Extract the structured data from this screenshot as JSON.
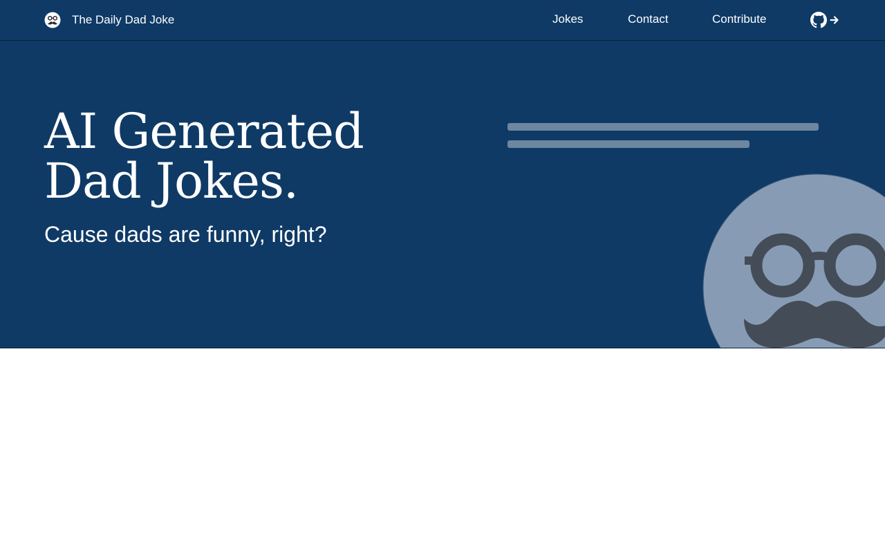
{
  "navbar": {
    "brand": "The Daily Dad Joke",
    "links": {
      "jokes": "Jokes",
      "contact": "Contact",
      "contribute": "Contribute"
    },
    "icons": {
      "logo": "dad-face-icon",
      "github": "github-icon",
      "arrow": "arrow-right-icon"
    }
  },
  "hero": {
    "title_line1": "AI Generated",
    "title_line2": "Dad Jokes.",
    "subtitle": "Cause dads are funny, right?",
    "loading_lines": 2
  },
  "colors": {
    "primary": "#0f3a66",
    "skeleton": "#6f86a1",
    "avatar_face": "#879cb4",
    "avatar_features": "#444c57",
    "text": "#ffffff",
    "background": "#ffffff"
  }
}
